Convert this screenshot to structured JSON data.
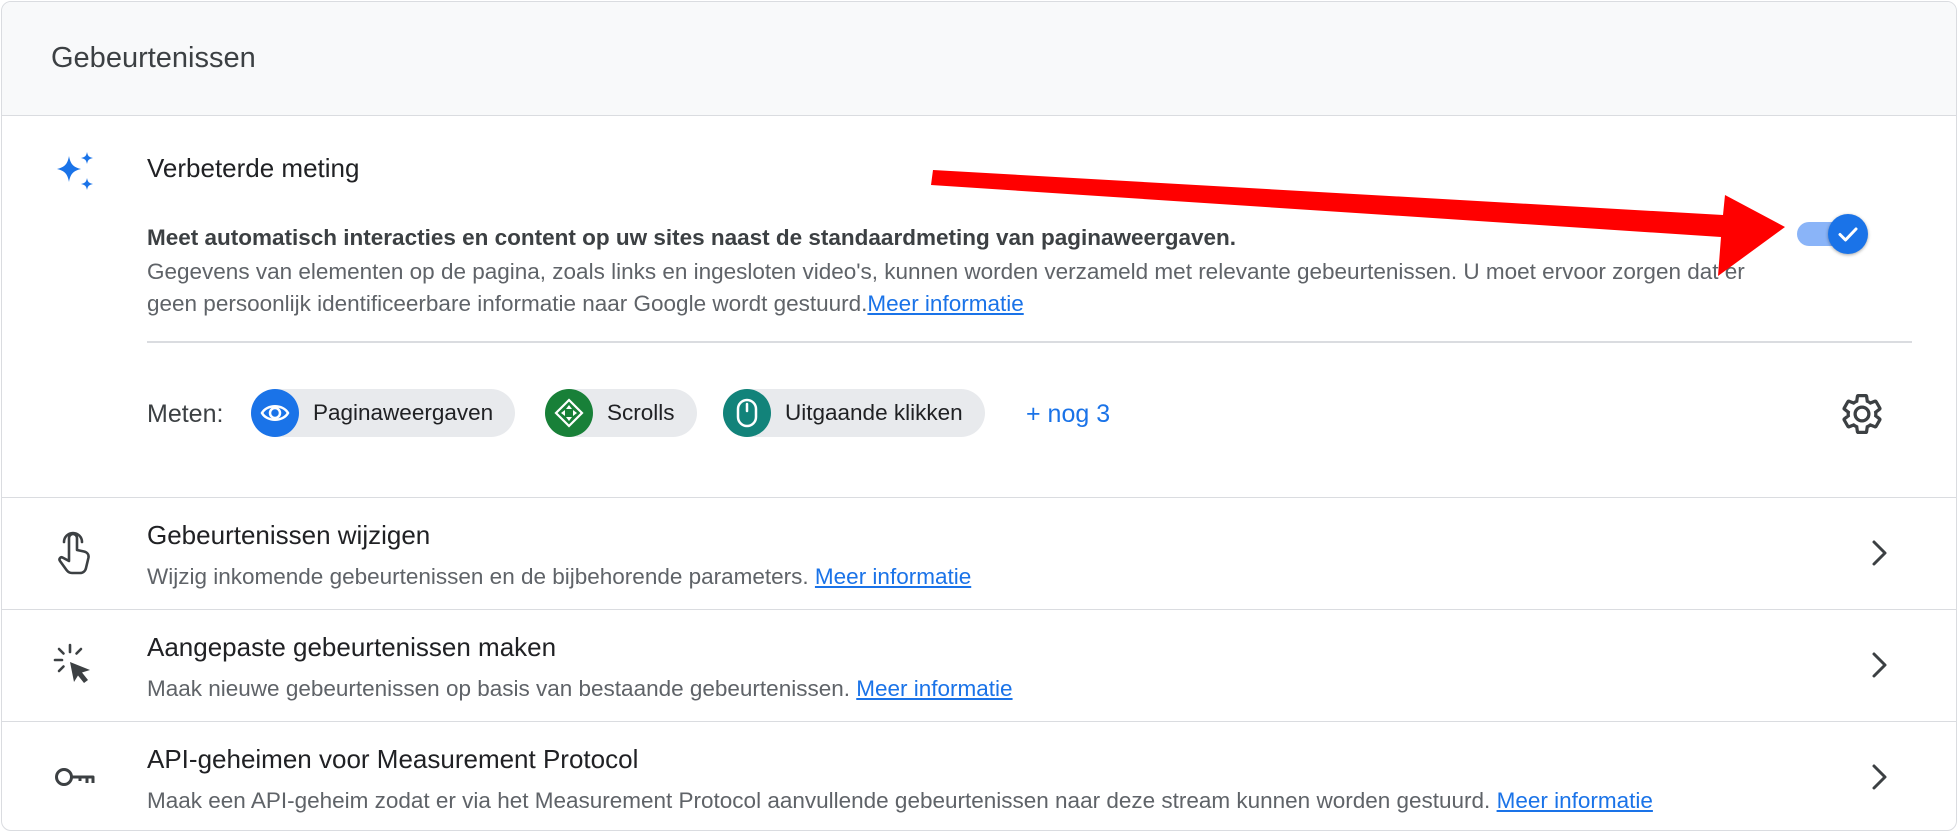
{
  "header": {
    "title": "Gebeurtenissen"
  },
  "enhanced_measurement": {
    "title": "Verbeterde meting",
    "bold_text": "Meet automatisch interacties en content op uw sites naast de standaardmeting van paginaweergaven.",
    "description": "Gegevens van elementen op de pagina, zoals links en ingesloten video's, kunnen worden verzameld met relevante gebeurtenissen. U moet ervoor zorgen dat er geen persoonlijk identificeerbare informatie naar Google wordt gestuurd.",
    "link": "Meer informatie",
    "toggle_on": true,
    "measure_label": "Meten:",
    "chips": [
      {
        "label": "Paginaweergaven",
        "icon": "eye-icon",
        "color": "#1a73e8"
      },
      {
        "label": "Scrolls",
        "icon": "scroll-icon",
        "color": "#188038"
      },
      {
        "label": "Uitgaande klikken",
        "icon": "mouse-icon",
        "color": "#12837a"
      }
    ],
    "more_link": "+ nog 3",
    "settings_icon": "gear-icon"
  },
  "rows": [
    {
      "title": "Gebeurtenissen wijzigen",
      "description": "Wijzig inkomende gebeurtenissen en de bijbehorende parameters.",
      "link": "Meer informatie",
      "icon": "touch-hand-icon"
    },
    {
      "title": "Aangepaste gebeurtenissen maken",
      "description": "Maak nieuwe gebeurtenissen op basis van bestaande gebeurtenissen.",
      "link": "Meer informatie",
      "icon": "cursor-click-icon"
    },
    {
      "title": "API-geheimen voor Measurement Protocol",
      "description": "Maak een API-geheim zodat er via het Measurement Protocol aanvullende gebeurtenissen naar deze stream kunnen worden gestuurd.",
      "link": "Meer informatie",
      "icon": "key-icon"
    }
  ],
  "colors": {
    "accent": "#1a73e8",
    "annotation_arrow": "#ff0000"
  }
}
